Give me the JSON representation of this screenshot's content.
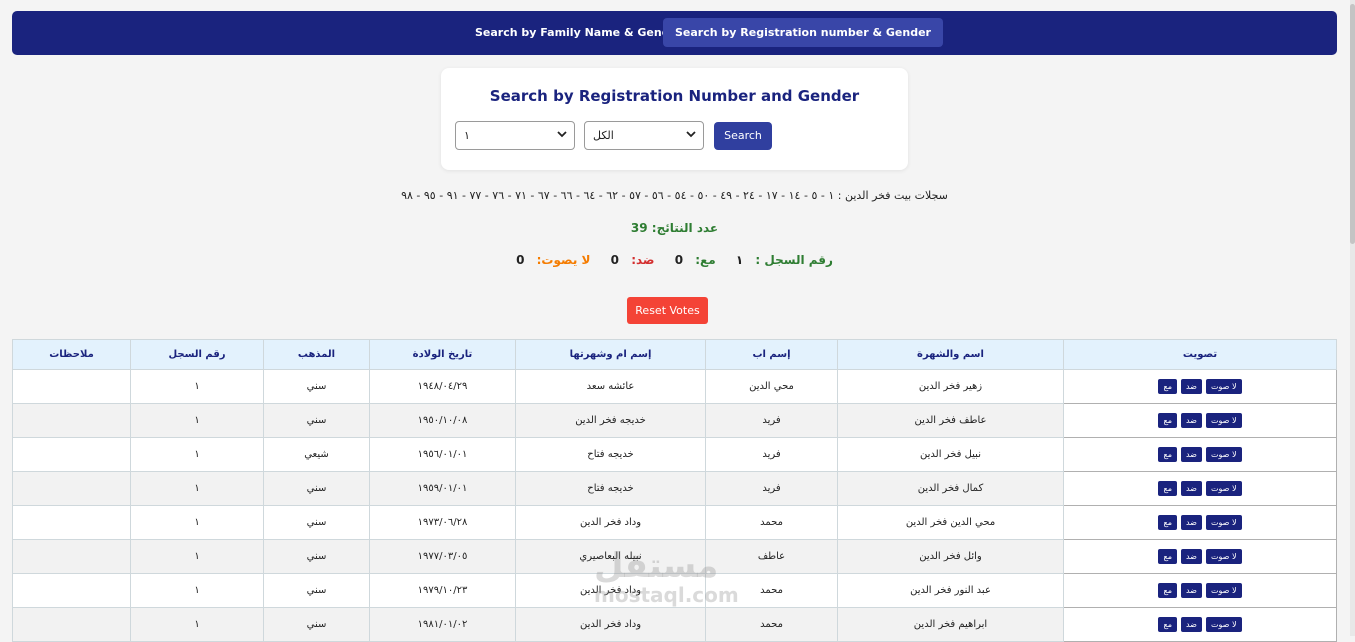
{
  "nav": {
    "tab_family": "Search by Family Name & Gender",
    "tab_registration": "Search by Registration number & Gender"
  },
  "search_card": {
    "title": "Search by Registration Number and Gender",
    "registration_select": "١",
    "gender_select": "الكل",
    "search_button": "Search"
  },
  "records_line": "سجلات بيت فخر الدين : ١ - ٥ - ١٤ - ١٧ - ٢٤ - ٤٩ - ٥٠ - ٥٤ - ٥٦ - ٥٧ - ٦٢ - ٦٤ - ٦٦ - ٦٧ - ٧١ - ٧٦ - ٧٧ - ٩١ - ٩٥ - ٩٨",
  "count": {
    "label": "عدد النتائج:",
    "value": "39"
  },
  "stats": {
    "record_label": "رقم السجل :",
    "record_value": "١",
    "with_label": "مع:",
    "with_value": "0",
    "against_label": "ضد:",
    "against_value": "0",
    "novote_label": "لا يصوت:",
    "novote_value": "0"
  },
  "reset_button": "Reset Votes",
  "table": {
    "headers": {
      "vote": "تصويت",
      "name": "اسم والشهرة",
      "father": "إسم اب",
      "mother": "إسم ام وشهرتها",
      "birth": "تاريخ الولادة",
      "sect": "المذهب",
      "record": "رقم السجل",
      "notes": "ملاحظات"
    },
    "vote_buttons": {
      "novote": "لا صوت",
      "against": "ضد",
      "with": "مع"
    },
    "rows": [
      {
        "name": "زهير فخر الدين",
        "father": "محي الدين",
        "mother": "عائشه سعد",
        "birth": "١٩٤٨/٠٤/٢٩",
        "sect": "سني",
        "record": "١",
        "notes": ""
      },
      {
        "name": "عاطف فخر الدين",
        "father": "فريد",
        "mother": "خديجه فخر الدين",
        "birth": "١٩٥٠/١٠/٠٨",
        "sect": "سني",
        "record": "١",
        "notes": ""
      },
      {
        "name": "نبيل فخر الدين",
        "father": "فريد",
        "mother": "خديجه فتاح",
        "birth": "١٩٥٦/٠١/٠١",
        "sect": "شيعي",
        "record": "١",
        "notes": ""
      },
      {
        "name": "كمال فخر الدين",
        "father": "فريد",
        "mother": "خديجه فتاح",
        "birth": "١٩٥٩/٠١/٠١",
        "sect": "سني",
        "record": "١",
        "notes": ""
      },
      {
        "name": "محي الدين فخر الدين",
        "father": "محمد",
        "mother": "وداد فخر الدين",
        "birth": "١٩٧٣/٠٦/٢٨",
        "sect": "سني",
        "record": "١",
        "notes": ""
      },
      {
        "name": "وائل فخر الدين",
        "father": "عاطف",
        "mother": "نبيله البعاصيري",
        "birth": "١٩٧٧/٠٣/٠٥",
        "sect": "سني",
        "record": "١",
        "notes": ""
      },
      {
        "name": "عبد النور فخر الدين",
        "father": "محمد",
        "mother": "وداد فخر الدين",
        "birth": "١٩٧٩/١٠/٢٣",
        "sect": "سني",
        "record": "١",
        "notes": ""
      },
      {
        "name": "ابراهيم فخر الدين",
        "father": "محمد",
        "mother": "وداد فخر الدين",
        "birth": "١٩٨١/٠١/٠٢",
        "sect": "سني",
        "record": "١",
        "notes": ""
      }
    ]
  },
  "watermark": {
    "text_ar": "مستقل",
    "text_en": "mostaql.com"
  }
}
